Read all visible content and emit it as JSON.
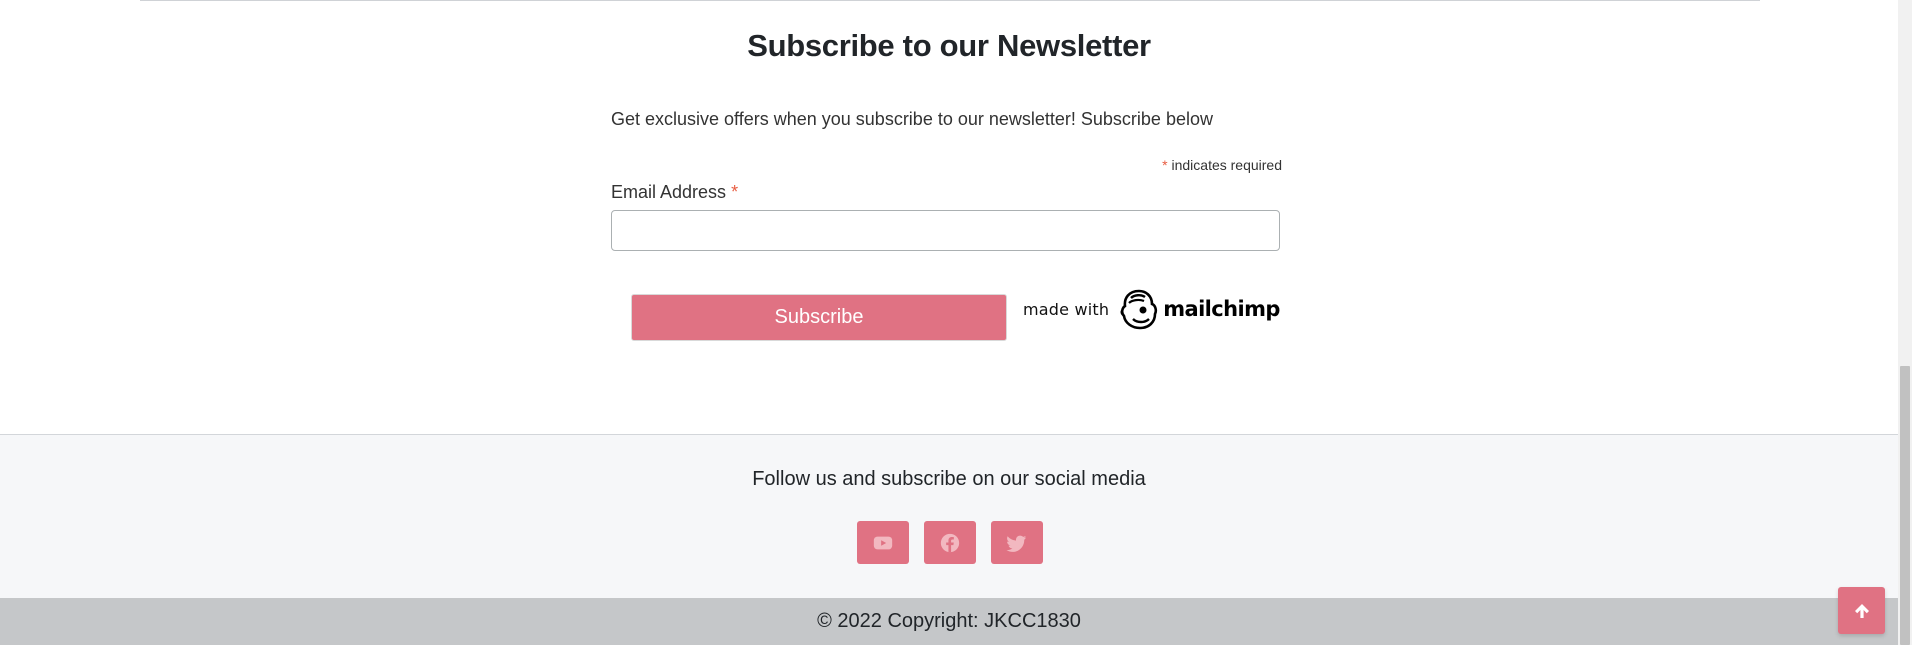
{
  "newsletter": {
    "title": "Subscribe to our Newsletter",
    "description": "Get exclusive offers when you subscribe to our newsletter! Subscribe below",
    "required_asterisk": "*",
    "required_note": " indicates required",
    "email_label": "Email Address ",
    "email_label_asterisk": "*",
    "email_value": "",
    "email_placeholder": "",
    "subscribe_label": "Subscribe",
    "made_with": "made with",
    "mailchimp_wordmark": "mailchimp"
  },
  "footer": {
    "social_heading": "Follow us and subscribe on our social media",
    "social_links": [
      {
        "icon": "youtube-icon"
      },
      {
        "icon": "facebook-icon"
      },
      {
        "icon": "twitter-icon"
      }
    ],
    "copyright": "© 2022 Copyright: JKCC1830"
  },
  "colors": {
    "accent": "#e07283",
    "footer_bg": "#f6f7f9",
    "copyright_bg": "#c5c7c9",
    "required": "#e85c41"
  }
}
